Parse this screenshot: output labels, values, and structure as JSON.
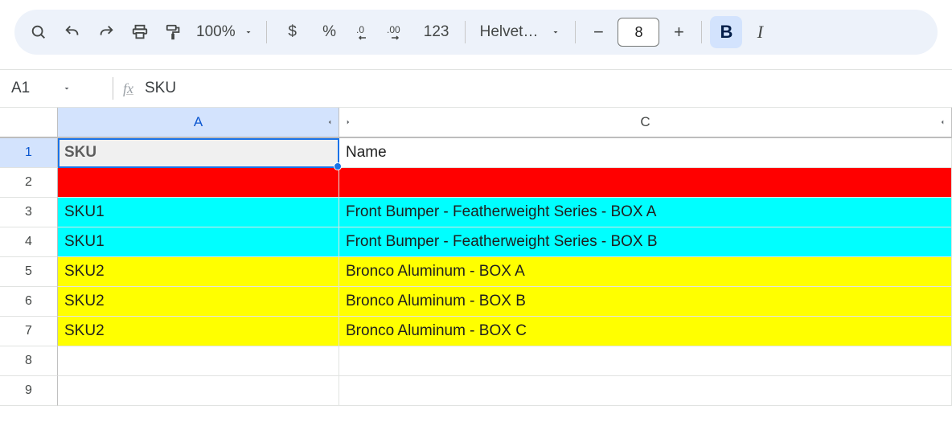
{
  "toolbar": {
    "zoom": "100%",
    "font_name": "Helvet…",
    "font_size": "8",
    "number_formats": [
      "$",
      "%",
      ".0",
      ".00",
      "123"
    ]
  },
  "formula_bar": {
    "cell_ref": "A1",
    "fx_label": "fx",
    "value": "SKU"
  },
  "columns": {
    "A": "A",
    "C": "C"
  },
  "rows": [
    "1",
    "2",
    "3",
    "4",
    "5",
    "6",
    "7",
    "8",
    "9"
  ],
  "cells": {
    "header": {
      "A": "SKU",
      "C": "Name"
    },
    "r3": {
      "A": "SKU1",
      "C": "Front Bumper - Featherweight Series - BOX A"
    },
    "r4": {
      "A": "SKU1",
      "C": "Front Bumper - Featherweight Series - BOX B"
    },
    "r5": {
      "A": "SKU2",
      "C": "Bronco Aluminum - BOX A"
    },
    "r6": {
      "A": "SKU2",
      "C": "Bronco Aluminum - BOX B"
    },
    "r7": {
      "A": "SKU2",
      "C": "Bronco Aluminum - BOX C"
    }
  },
  "row_colors": {
    "2": "#ff0000",
    "3": "#00ffff",
    "4": "#00ffff",
    "5": "#ffff00",
    "6": "#ffff00",
    "7": "#ffff00"
  }
}
